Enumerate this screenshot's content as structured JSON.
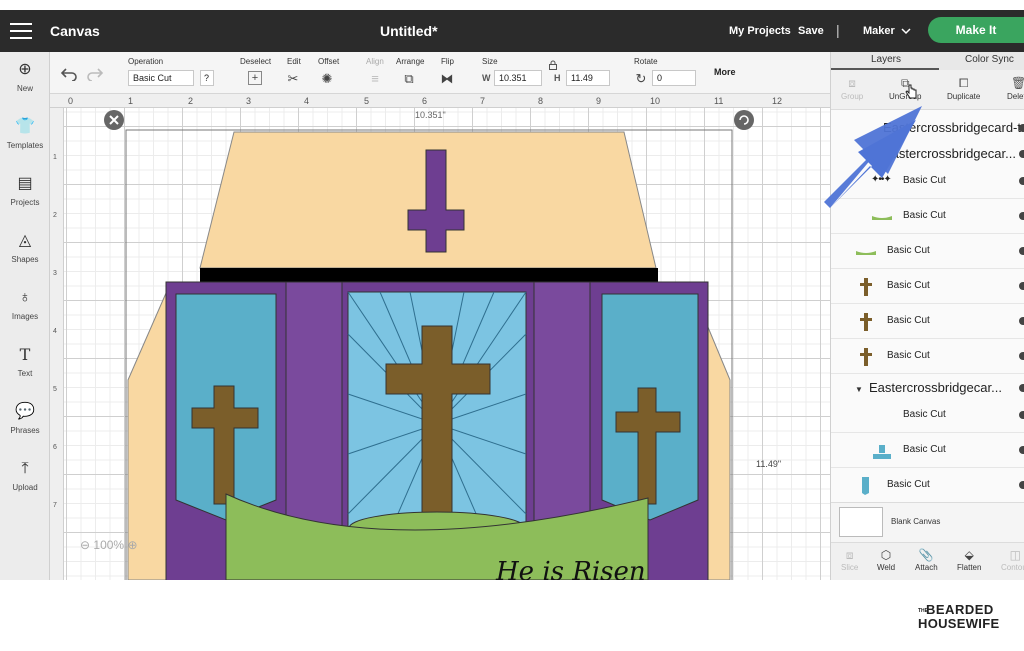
{
  "app": {
    "title": "Canvas",
    "document_title": "Untitled*"
  },
  "topbar": {
    "my_projects": "My Projects",
    "save": "Save",
    "separator": "|",
    "machine": "Maker",
    "make_it": "Make It"
  },
  "toolbar": {
    "operation_label": "Operation",
    "operation_value": "Basic Cut",
    "help": "?",
    "deselect_label": "Deselect",
    "edit_label": "Edit",
    "offset_label": "Offset",
    "align_label": "Align",
    "arrange_label": "Arrange",
    "flip_label": "Flip",
    "size_label": "Size",
    "w_label": "W",
    "w_value": "10.351",
    "h_label": "H",
    "h_value": "11.49",
    "rotate_label": "Rotate",
    "rotate_value": "0",
    "more": "More"
  },
  "sidebar": {
    "items": [
      {
        "label": "New",
        "icon": "plus-circle-icon"
      },
      {
        "label": "Templates",
        "icon": "shirt-icon"
      },
      {
        "label": "Projects",
        "icon": "projects-icon"
      },
      {
        "label": "Shapes",
        "icon": "shapes-icon"
      },
      {
        "label": "Images",
        "icon": "lightbulb-icon"
      },
      {
        "label": "Text",
        "icon": "text-icon"
      },
      {
        "label": "Phrases",
        "icon": "speech-bubble-icon"
      },
      {
        "label": "Upload",
        "icon": "upload-icon"
      }
    ]
  },
  "ruler": {
    "top": [
      "0",
      "1",
      "2",
      "3",
      "4",
      "5",
      "6",
      "7",
      "8",
      "9",
      "10",
      "11",
      "12"
    ],
    "left": [
      "1",
      "2",
      "3",
      "4",
      "5",
      "6",
      "7"
    ]
  },
  "canvas": {
    "width_readout": "10.351\"",
    "height_readout": "11.49\"",
    "zoom": "100%",
    "card_text": "He is Risen"
  },
  "panel": {
    "tabs": [
      "Layers",
      "Color Sync"
    ],
    "tools": [
      "Group",
      "UnGroup",
      "Duplicate",
      "Delete"
    ],
    "layers": [
      {
        "kind": "group",
        "name": "Eastercrossbridgecard-t..."
      },
      {
        "kind": "group",
        "name": "Eastercrossbridgecar..."
      },
      {
        "kind": "item",
        "name": "Basic Cut",
        "thumb": "dots"
      },
      {
        "kind": "item",
        "name": "Basic Cut",
        "thumb": "green-bar"
      },
      {
        "kind": "item",
        "name": "Basic Cut",
        "thumb": "green-bar"
      },
      {
        "kind": "item",
        "name": "Basic Cut",
        "thumb": "cross"
      },
      {
        "kind": "item",
        "name": "Basic Cut",
        "thumb": "cross"
      },
      {
        "kind": "item",
        "name": "Basic Cut",
        "thumb": "cross"
      },
      {
        "kind": "group",
        "name": "Eastercrossbridgecar..."
      },
      {
        "kind": "item",
        "name": "Basic Cut",
        "thumb": "none"
      },
      {
        "kind": "item",
        "name": "Basic Cut",
        "thumb": "tombstone"
      },
      {
        "kind": "item",
        "name": "Basic Cut",
        "thumb": "blue-panel"
      }
    ],
    "blank_canvas": "Blank Canvas",
    "bottom_tools": [
      "Slice",
      "Weld",
      "Attach",
      "Flatten",
      "Contour"
    ]
  },
  "colors": {
    "topbar": "#2b2b2b",
    "make_it": "#3aa55f",
    "peach": "#f9d8a2",
    "purple": "#6e3e91",
    "blue": "#5aafc9",
    "light_blue": "#7cc4e2",
    "brown": "#7b5e2a",
    "green": "#8dbd5a",
    "arrow": "#4f74d6"
  },
  "brand": {
    "small": "THE",
    "line1": "BEARDED",
    "line2": "HOUSEWIFE"
  }
}
